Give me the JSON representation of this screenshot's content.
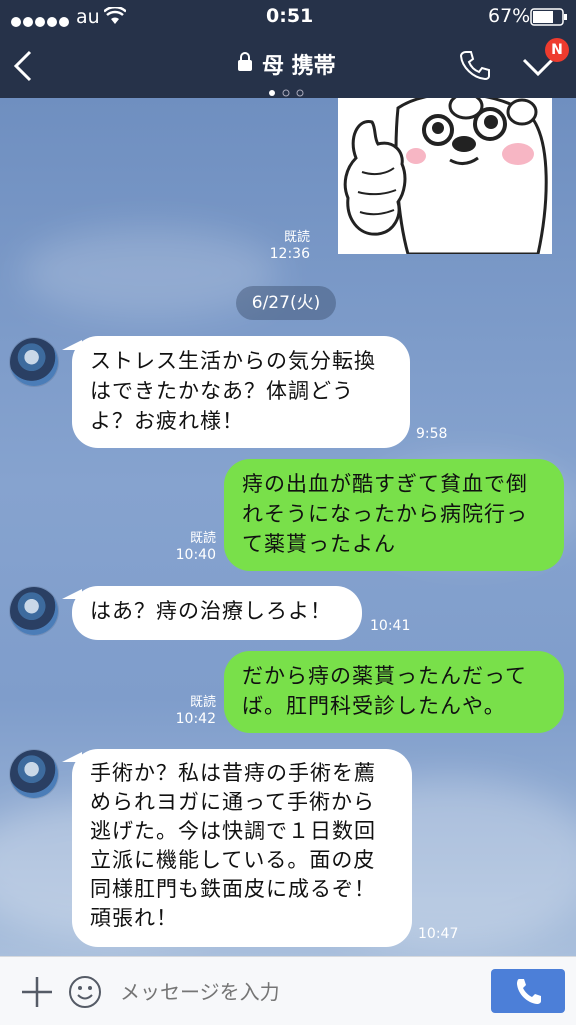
{
  "status": {
    "carrier": "au",
    "time": "0:51",
    "battery": "67%"
  },
  "header": {
    "title": "母 携帯",
    "notify_badge": "N"
  },
  "sticker_meta": {
    "read": "既読",
    "time": "12:36"
  },
  "date_chip": "6/27(火)",
  "messages": [
    {
      "text1": "ストレス生活からの気分転換",
      "text2": "はできたかなあ？体調どう",
      "text3": "よ？お疲れ様！",
      "time": "9:58"
    },
    {
      "text1": "痔の出血が酷すぎて貧血で倒",
      "text2": "れそうになったから病院行っ",
      "text3": "て薬貰ったよん",
      "read": "既読",
      "time": "10:40"
    },
    {
      "text1": "はあ？痔の治療しろよ！",
      "time": "10:41"
    },
    {
      "text1": "だから痔の薬貰ったんだって",
      "text2": "ば。肛門科受診したんや。",
      "read": "既読",
      "time": "10:42"
    },
    {
      "text1": "手術か？私は昔痔の手術を薦",
      "text2": "められヨガに通って手術から",
      "text3": "逃げた。今は快調で１日数回",
      "text4": "立派に機能している。面の皮",
      "text5": "同様肛門も鉄面皮に成るぞ！",
      "text6": "頑張れ！",
      "time": "10:47"
    }
  ],
  "input": {
    "placeholder": "メッセージを入力"
  }
}
